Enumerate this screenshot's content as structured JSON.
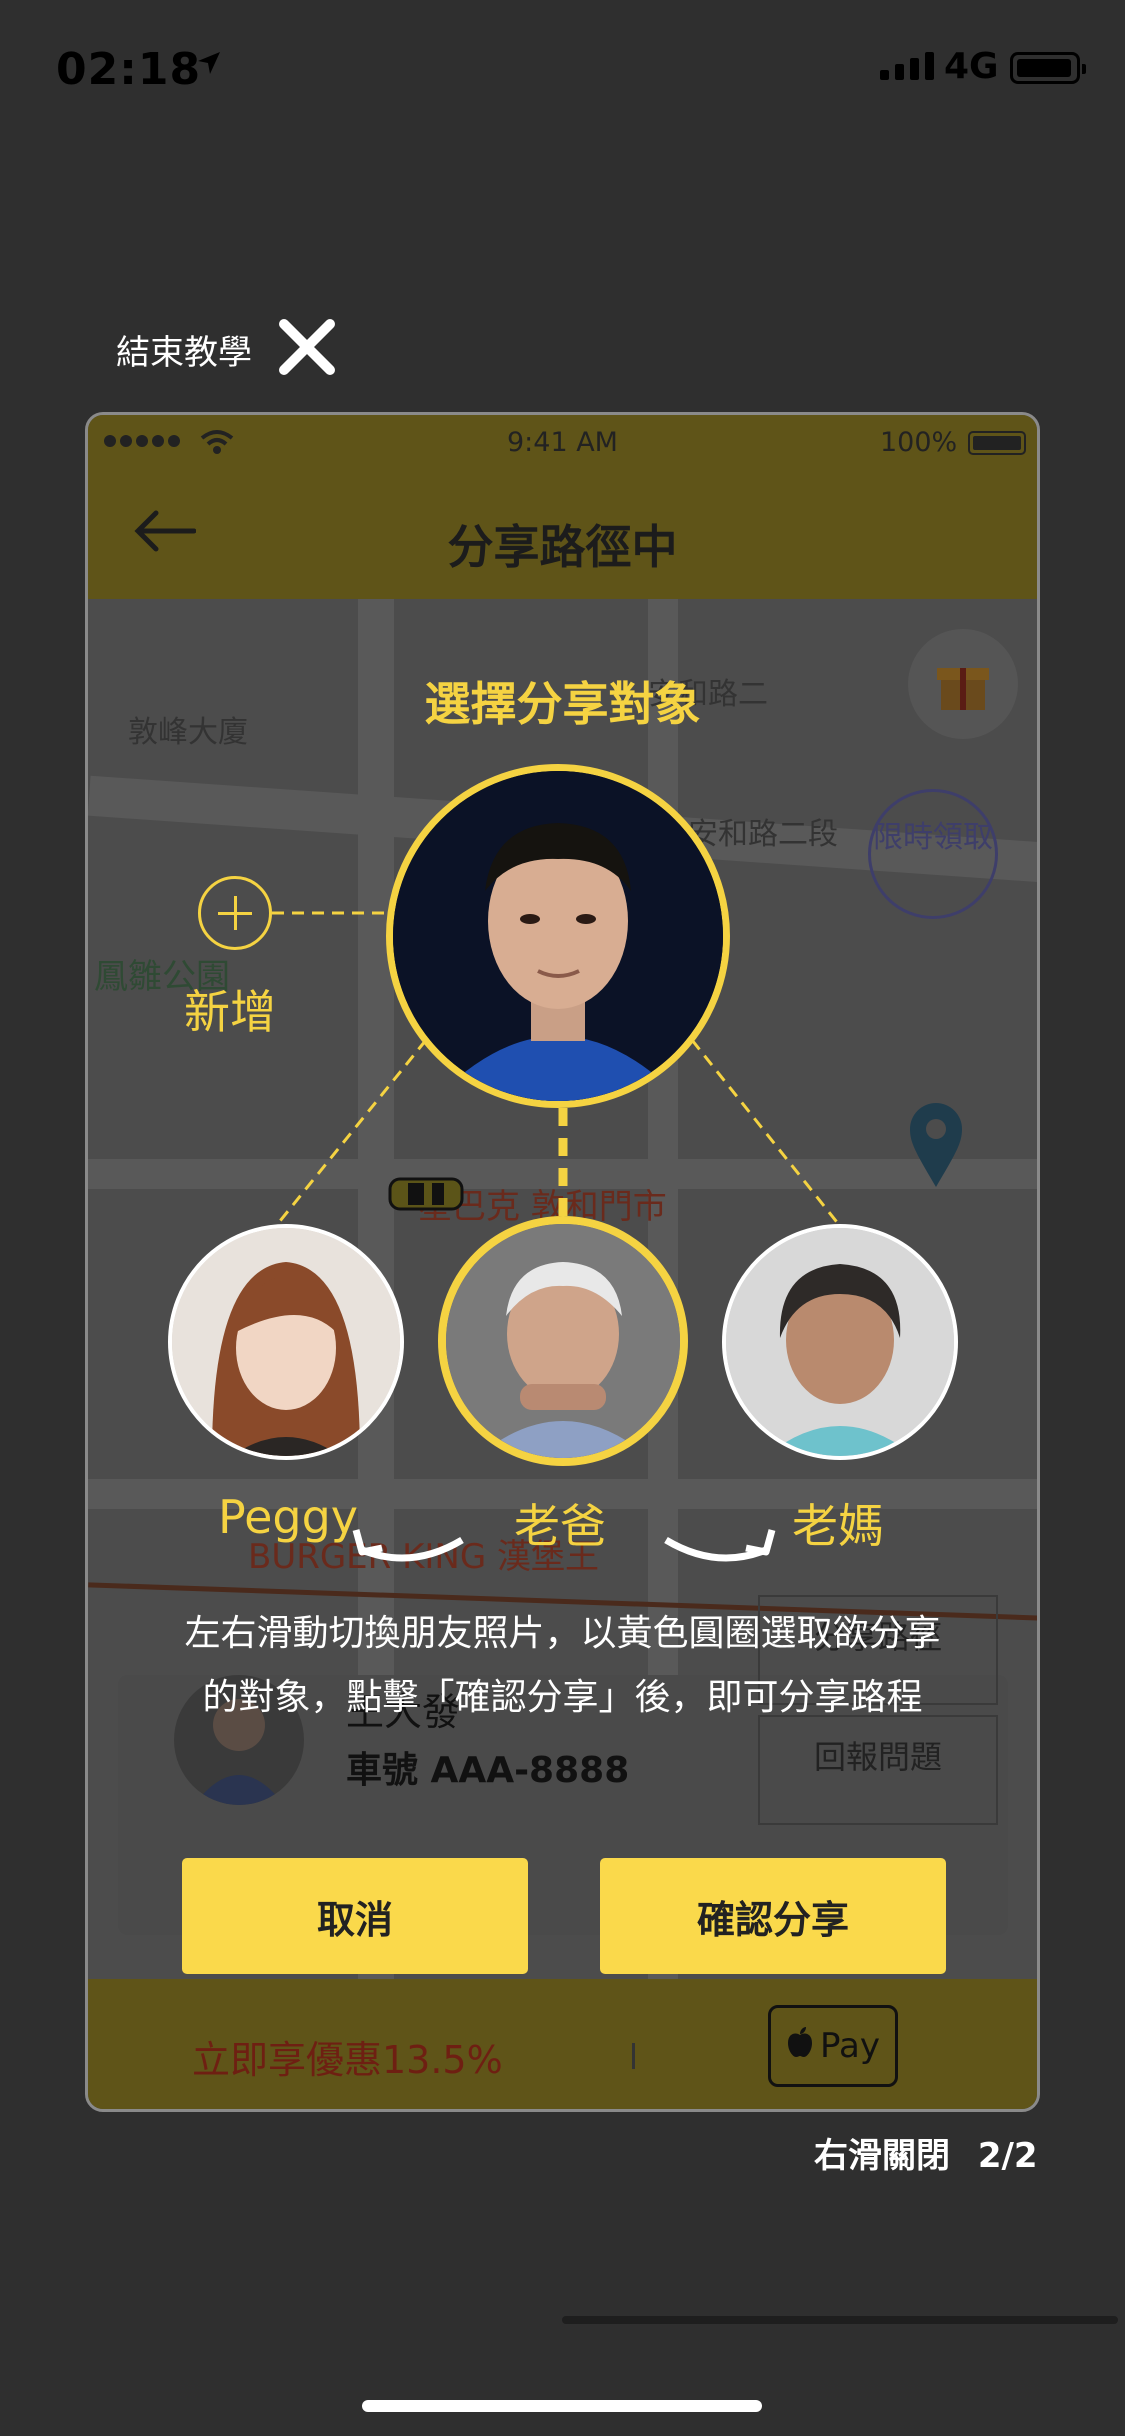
{
  "status_bar": {
    "time": "02:18",
    "network": "4G"
  },
  "tutorial": {
    "end_label": "結束教學",
    "heading": "選擇分享對象",
    "add_label": "新增",
    "friends": [
      {
        "name": "Peggy"
      },
      {
        "name": "老爸"
      },
      {
        "name": "老媽"
      }
    ],
    "instruction_line1": "左右滑動切換朋友照片，以黃色圓圈選取欲分享",
    "instruction_line2": "的對象，點擊「確認分享」後，即可分享路程",
    "cancel_label": "取消",
    "confirm_label": "確認分享",
    "swipe_close": "右滑關閉",
    "page_indicator": "2/2"
  },
  "mock_phone": {
    "time": "9:41 AM",
    "battery": "100%",
    "title": "分享路徑中",
    "map_labels": {
      "building": "敦峰大廈",
      "road_1": "安和路二",
      "road_2": "安和路二段",
      "park": "鳳雛公園",
      "starbucks": "星巴克 敦和門市",
      "burger": "BURGER KING 漢堡王",
      "limited": "限時領取"
    },
    "driver_name": "王大發",
    "driver_plate": "車號 AAA-8888",
    "share_route_label": "分享路徑",
    "report_label": "回報問題",
    "promo": "立即享優惠13.5%",
    "pay_label": "Pay"
  },
  "colors": {
    "accent": "#f5d342",
    "button": "#fad94b",
    "overlay_bg": "#2f2f2f"
  }
}
